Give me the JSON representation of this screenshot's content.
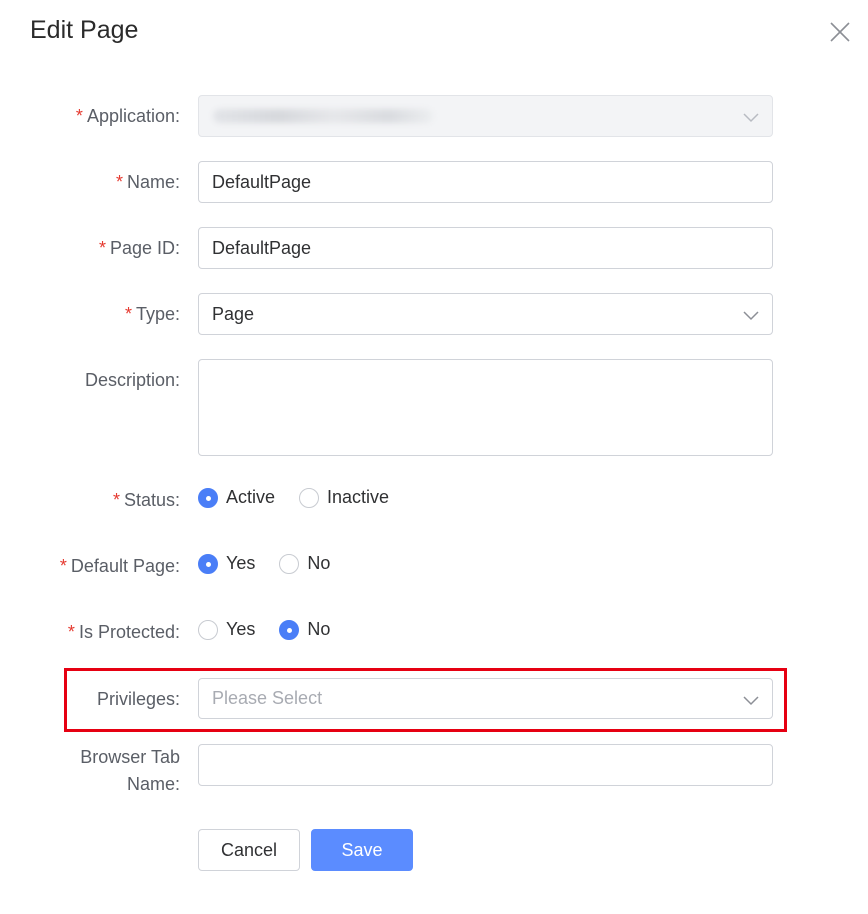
{
  "dialog": {
    "title": "Edit Page",
    "close_icon": "close-icon"
  },
  "form": {
    "application": {
      "label": "Application:",
      "required": "*"
    },
    "name": {
      "label": "Name:",
      "required": "*",
      "value": "DefaultPage"
    },
    "page_id": {
      "label": "Page ID:",
      "required": "*",
      "value": "DefaultPage"
    },
    "type": {
      "label": "Type:",
      "required": "*",
      "value": "Page"
    },
    "description": {
      "label": "Description:",
      "value": ""
    },
    "status": {
      "label": "Status:",
      "required": "*",
      "options": [
        "Active",
        "Inactive"
      ],
      "selected": "Active"
    },
    "default_page": {
      "label": "Default Page:",
      "required": "*",
      "options": [
        "Yes",
        "No"
      ],
      "selected": "Yes"
    },
    "is_protected": {
      "label": "Is Protected:",
      "required": "*",
      "options": [
        "Yes",
        "No"
      ],
      "selected": "No"
    },
    "privileges": {
      "label": "Privileges:",
      "placeholder": "Please Select"
    },
    "browser_tab_name": {
      "label_line1": "Browser Tab",
      "label_line2": "Name:",
      "value": ""
    }
  },
  "buttons": {
    "cancel": "Cancel",
    "save": "Save"
  },
  "colors": {
    "primary": "#5b8cff",
    "radio_checked": "#4a7ef7",
    "required_asterisk": "#e5392f",
    "highlight_border": "#e60012"
  }
}
